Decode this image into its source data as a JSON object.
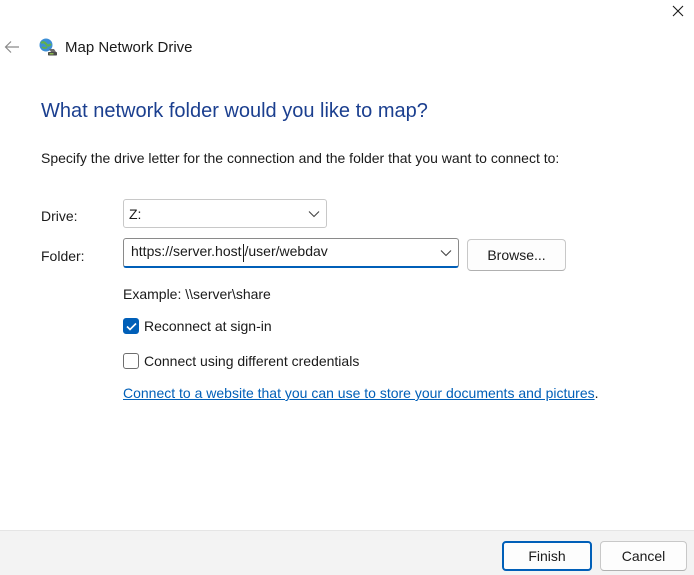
{
  "window": {
    "title": "Map Network Drive",
    "icons": {
      "back": "arrow-left-icon",
      "close": "close-icon",
      "app": "network-drive-icon"
    }
  },
  "main": {
    "heading": "What network folder would you like to map?",
    "instruction": "Specify the drive letter for the connection and the folder that you want to connect to:",
    "drive": {
      "label": "Drive:",
      "value": "Z:"
    },
    "folder": {
      "label": "Folder:",
      "value_before_caret": "https://server.host",
      "value_after_caret": "/user/webdav"
    },
    "browse_label": "Browse...",
    "example": "Example: \\\\server\\share",
    "reconnect": {
      "label": "Reconnect at sign-in",
      "checked": true
    },
    "different_credentials": {
      "label": "Connect using different credentials",
      "checked": false
    },
    "website_link": "Connect to a website that you can use to store your documents and pictures",
    "link_period": "."
  },
  "footer": {
    "finish_label": "Finish",
    "cancel_label": "Cancel"
  },
  "colors": {
    "heading": "#1b3f8f",
    "accent": "#005fb8",
    "footer_bg": "#f3f3f3"
  }
}
